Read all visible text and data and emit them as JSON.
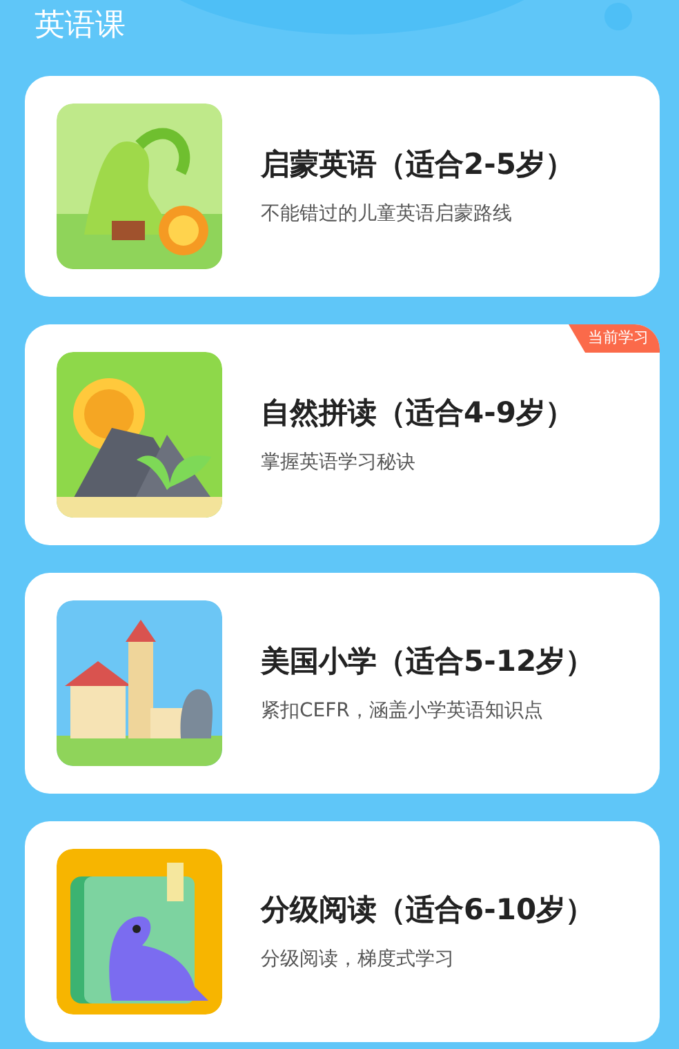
{
  "header": {
    "title": "英语课"
  },
  "courses": [
    {
      "title": "启蒙英语（适合2-5岁）",
      "subtitle": "不能错过的儿童英语启蒙路线"
    },
    {
      "title": "自然拼读（适合4-9岁）",
      "subtitle": "掌握英语学习秘诀",
      "badge": "当前学习"
    },
    {
      "title": "美国小学（适合5-12岁）",
      "subtitle": "紧扣CEFR，涵盖小学英语知识点"
    },
    {
      "title": "分级阅读（适合6-10岁）",
      "subtitle": "分级阅读，梯度式学习"
    }
  ]
}
